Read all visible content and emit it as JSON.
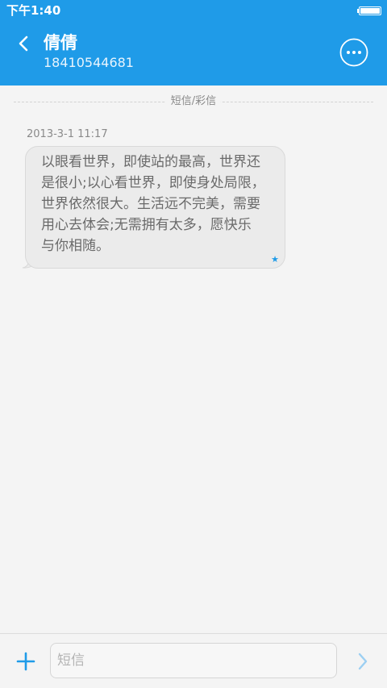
{
  "status_bar": {
    "time": "下午1:40",
    "battery_level": 1
  },
  "conversation": {
    "contact_name": "倩倩",
    "phone_number": "18410544681"
  },
  "thread": {
    "channel_label": "短信/彩信",
    "messages": [
      {
        "timestamp": "2013-3-1 11:17",
        "text": "以眼看世界，即使站的最高，世界还\n是很小;以心看世界，即使身处局限，\n世界依然很大。生活远不完美，需要\n用心去体会;无需拥有太多，愿快乐\n与你相随。",
        "starred": true,
        "star_glyph": "★"
      }
    ]
  },
  "composer": {
    "placeholder": "短信"
  },
  "colors": {
    "header": "#1f9be8",
    "background": "#f4f4f4",
    "bubble": "#ebebeb",
    "accent": "#1f9be8"
  },
  "icons": {
    "back": "chevron-left-icon",
    "more": "ellipsis-circle-icon",
    "add": "plus-icon",
    "send": "chevron-right-icon",
    "battery": "battery-icon",
    "star": "star-icon"
  }
}
